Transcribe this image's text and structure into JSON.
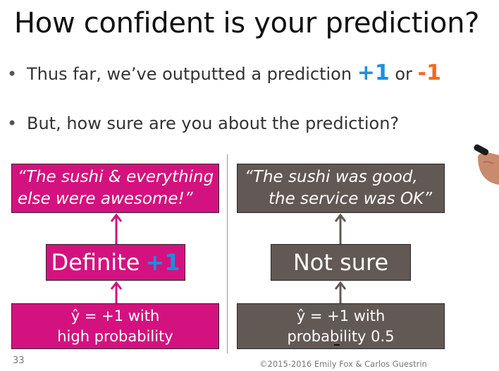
{
  "slide": {
    "title": "How confident is your prediction?",
    "bullets": [
      {
        "text": "Thus far, we’ve outputted a prediction ",
        "plus": "+1",
        "conj": " or ",
        "minus": "-1"
      },
      {
        "text": "But, how sure are you about the prediction?"
      }
    ],
    "left": {
      "quote_line1": "“The sushi & everything",
      "quote_line2": "else were awesome!”",
      "middle_label": "Definite",
      "middle_value": "+1",
      "bottom_line1": "ŷ = +1 with",
      "bottom_line2": "high probability"
    },
    "right": {
      "quote_line1": "“The sushi was good,",
      "quote_line2": "the service was OK”",
      "middle_label": "Not sure",
      "bottom_line1": "ŷ = +1 with",
      "bottom_line2": "probability 0.5"
    },
    "page_number": "33",
    "copyright": "©2015-2016 Emily Fox & Carlos Guestrin"
  },
  "colors": {
    "pink": "#d3127f",
    "gray": "#625854",
    "plus_blue": "#1a8fe0",
    "minus_orange": "#f26a22"
  }
}
